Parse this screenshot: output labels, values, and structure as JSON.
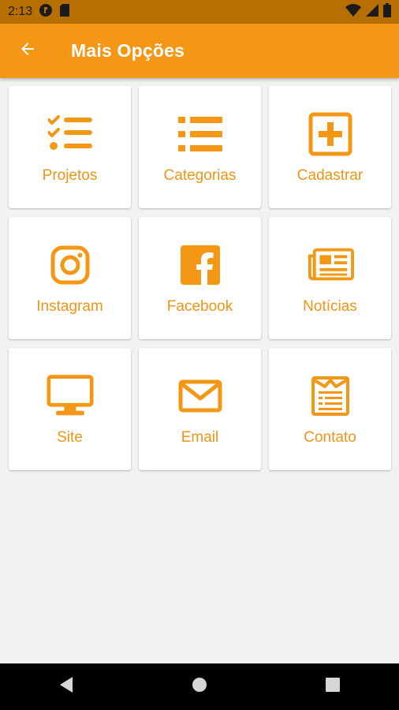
{
  "status_bar": {
    "time": "2:13",
    "icons": [
      "circle-notification-icon",
      "sd-card-icon",
      "wifi-icon",
      "signal-icon",
      "battery-icon"
    ]
  },
  "app_bar": {
    "title": "Mais Opções",
    "back_icon": "arrow-back-icon"
  },
  "colors": {
    "accent": "#f39714",
    "status_bar": "#b66f00",
    "label": "#ef9416",
    "background": "#f2f2f2"
  },
  "tiles": [
    {
      "label": "Projetos",
      "icon": "checklist-icon"
    },
    {
      "label": "Categorias",
      "icon": "list-icon"
    },
    {
      "label": "Cadastrar",
      "icon": "plus-square-icon"
    },
    {
      "label": "Instagram",
      "icon": "instagram-icon"
    },
    {
      "label": "Facebook",
      "icon": "facebook-icon"
    },
    {
      "label": "Notícias",
      "icon": "newspaper-icon"
    },
    {
      "label": "Site",
      "icon": "monitor-icon"
    },
    {
      "label": "Email",
      "icon": "envelope-icon"
    },
    {
      "label": "Contato",
      "icon": "contact-form-icon"
    }
  ],
  "nav_bar": {
    "buttons": [
      "back-triangle-icon",
      "home-circle-icon",
      "recents-square-icon"
    ]
  }
}
